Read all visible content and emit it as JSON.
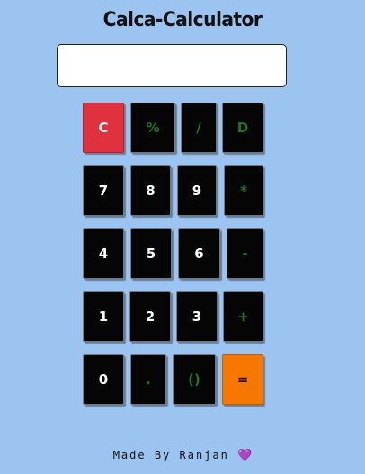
{
  "app": {
    "title": "Calca-Calculator"
  },
  "display": {
    "value": "",
    "placeholder": ""
  },
  "keys": {
    "clear": "C",
    "percent": "%",
    "divide": "/",
    "delete": "D",
    "seven": "7",
    "eight": "8",
    "nine": "9",
    "multiply": "*",
    "four": "4",
    "five": "5",
    "six": "6",
    "subtract": "-",
    "one": "1",
    "two": "2",
    "three": "3",
    "add": "+",
    "zero": "0",
    "decimal": ".",
    "parentheses": "()",
    "equals": "="
  },
  "footer": {
    "text": "Made By Ranjan",
    "heart_glyph": "💜"
  },
  "colors": {
    "background": "#9cc4f1",
    "key": "#050505",
    "clear": "#e0313f",
    "equals": "#f77800",
    "operator_text": "#1a7a1a"
  }
}
